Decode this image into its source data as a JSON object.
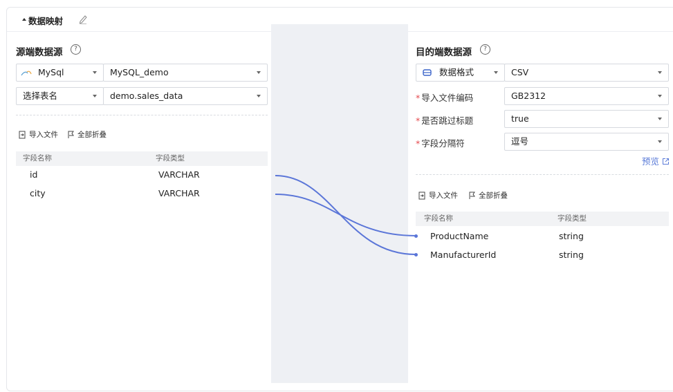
{
  "header": {
    "title": "数据映射",
    "edit_icon": "pencil-icon",
    "collapse_icon": "caret-up-icon"
  },
  "source": {
    "title": "源端数据源",
    "help_icon": "?",
    "db_type": "MySql",
    "connection": "MySQL_demo",
    "table_select_label": "选择表名",
    "table_name": "demo.sales_data",
    "import_file": "导入文件",
    "collapse_all": "全部折叠",
    "columns": {
      "name": "字段名称",
      "type": "字段类型"
    },
    "fields": [
      {
        "name": "id",
        "type": "VARCHAR"
      },
      {
        "name": "city",
        "type": "VARCHAR"
      }
    ]
  },
  "target": {
    "title": "目的端数据源",
    "help_icon": "?",
    "format_label": "数据格式",
    "format_value": "CSV",
    "encoding_label": "导入文件编码",
    "encoding_value": "GB2312",
    "skip_header_label": "是否跳过标题",
    "skip_header_value": "true",
    "separator_label": "字段分隔符",
    "separator_value": "逗号",
    "preview_link": "预览",
    "required_mark": "*",
    "import_file": "导入文件",
    "collapse_all": "全部折叠",
    "columns": {
      "name": "字段名称",
      "type": "字段类型"
    },
    "fields": [
      {
        "name": "ProductName",
        "type": "string"
      },
      {
        "name": "ManufacturerId",
        "type": "string"
      }
    ]
  },
  "mapping": [
    {
      "from": "id",
      "to": "ManufacturerId"
    },
    {
      "from": "city",
      "to": "ProductName"
    }
  ],
  "colors": {
    "accent": "#5b76d8",
    "middle_bg": "#eef0f4",
    "required": "#e5484d"
  }
}
